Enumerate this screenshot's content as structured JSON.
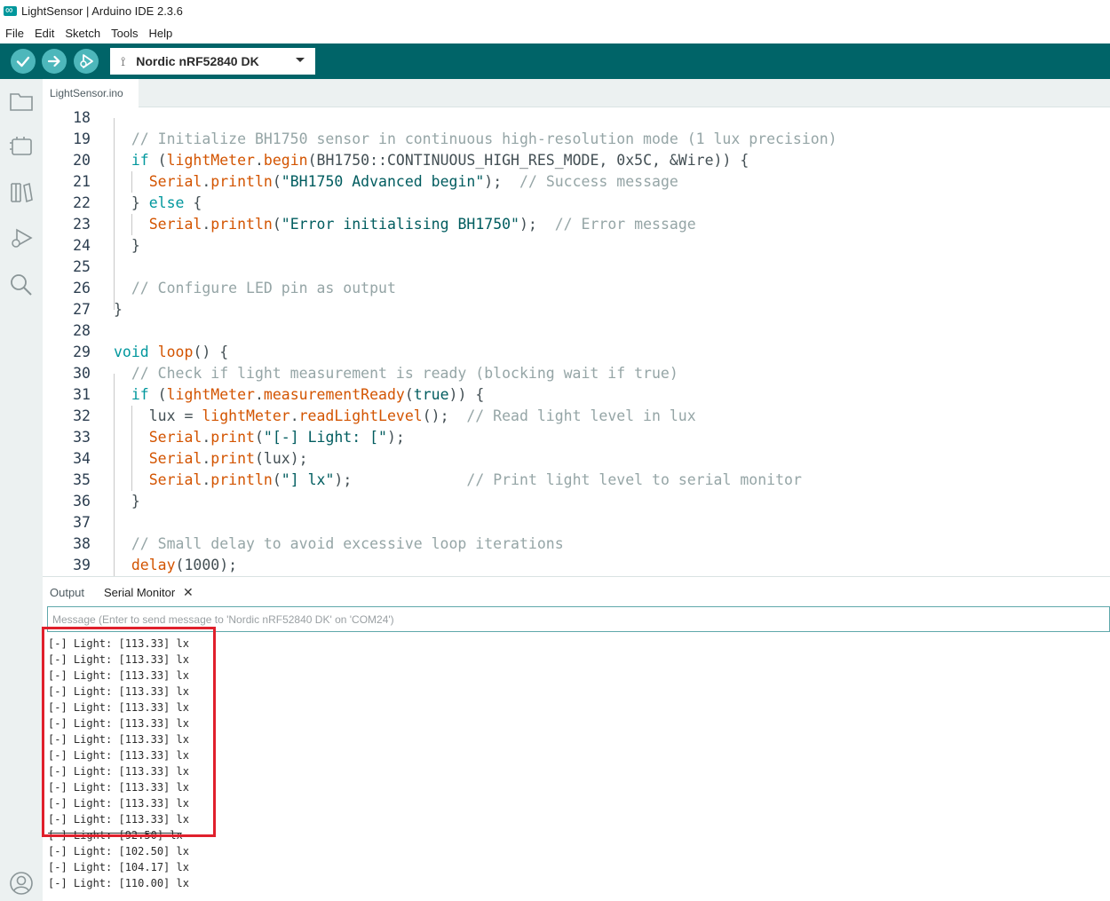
{
  "window": {
    "title": "LightSensor | Arduino IDE 2.3.6"
  },
  "menu": [
    "File",
    "Edit",
    "Sketch",
    "Tools",
    "Help"
  ],
  "toolbar": {
    "verify_icon": "check-icon",
    "upload_icon": "arrow-right-icon",
    "debug_icon": "debug-icon",
    "board": "Nordic nRF52840 DK",
    "colors": {
      "bar": "#006468",
      "button": "#4db7bb"
    }
  },
  "sidebar": {
    "icons": [
      "folder-icon",
      "board-manager-icon",
      "library-icon",
      "debug-icon",
      "search-icon",
      "account-icon"
    ]
  },
  "editor": {
    "tab": "LightSensor.ino",
    "lines": [
      {
        "num": "18",
        "segs": []
      },
      {
        "num": "19",
        "segs": [
          {
            "t": "  // Initialize BH1750 sensor in continuous high-resolution mode (1 lux precision)",
            "c": "cm"
          }
        ]
      },
      {
        "num": "20",
        "segs": [
          {
            "t": "  ",
            "c": "tx"
          },
          {
            "t": "if",
            "c": "kw"
          },
          {
            "t": " (",
            "c": "tx"
          },
          {
            "t": "lightMeter",
            "c": "fn"
          },
          {
            "t": ".",
            "c": "tx"
          },
          {
            "t": "begin",
            "c": "fn"
          },
          {
            "t": "(BH1750::CONTINUOUS_HIGH_RES_MODE, 0x5C, &Wire)) {",
            "c": "tx"
          }
        ]
      },
      {
        "num": "21",
        "segs": [
          {
            "t": "    ",
            "c": "tx"
          },
          {
            "t": "Serial",
            "c": "fn"
          },
          {
            "t": ".",
            "c": "tx"
          },
          {
            "t": "println",
            "c": "fn"
          },
          {
            "t": "(",
            "c": "tx"
          },
          {
            "t": "\"BH1750 Advanced begin\"",
            "c": "st"
          },
          {
            "t": ");  ",
            "c": "tx"
          },
          {
            "t": "// Success message",
            "c": "cm"
          }
        ]
      },
      {
        "num": "22",
        "segs": [
          {
            "t": "  } ",
            "c": "tx"
          },
          {
            "t": "else",
            "c": "kw"
          },
          {
            "t": " {",
            "c": "tx"
          }
        ]
      },
      {
        "num": "23",
        "segs": [
          {
            "t": "    ",
            "c": "tx"
          },
          {
            "t": "Serial",
            "c": "fn"
          },
          {
            "t": ".",
            "c": "tx"
          },
          {
            "t": "println",
            "c": "fn"
          },
          {
            "t": "(",
            "c": "tx"
          },
          {
            "t": "\"Error initialising BH1750\"",
            "c": "st"
          },
          {
            "t": ");  ",
            "c": "tx"
          },
          {
            "t": "// Error message",
            "c": "cm"
          }
        ]
      },
      {
        "num": "24",
        "segs": [
          {
            "t": "  }",
            "c": "tx"
          }
        ]
      },
      {
        "num": "25",
        "segs": []
      },
      {
        "num": "26",
        "segs": [
          {
            "t": "  // Configure LED pin as output",
            "c": "cm"
          }
        ]
      },
      {
        "num": "27",
        "segs": [
          {
            "t": "}",
            "c": "tx"
          }
        ]
      },
      {
        "num": "28",
        "segs": []
      },
      {
        "num": "29",
        "segs": [
          {
            "t": "void",
            "c": "kw"
          },
          {
            "t": " ",
            "c": "tx"
          },
          {
            "t": "loop",
            "c": "fn"
          },
          {
            "t": "() {",
            "c": "tx"
          }
        ]
      },
      {
        "num": "30",
        "segs": [
          {
            "t": "  // Check if light measurement is ready (blocking wait if true)",
            "c": "cm"
          }
        ]
      },
      {
        "num": "31",
        "segs": [
          {
            "t": "  ",
            "c": "tx"
          },
          {
            "t": "if",
            "c": "kw"
          },
          {
            "t": " (",
            "c": "tx"
          },
          {
            "t": "lightMeter",
            "c": "fn"
          },
          {
            "t": ".",
            "c": "tx"
          },
          {
            "t": "measurementReady",
            "c": "fn"
          },
          {
            "t": "(",
            "c": "tx"
          },
          {
            "t": "true",
            "c": "st"
          },
          {
            "t": ")) {",
            "c": "tx"
          }
        ]
      },
      {
        "num": "32",
        "segs": [
          {
            "t": "    lux = ",
            "c": "tx"
          },
          {
            "t": "lightMeter",
            "c": "fn"
          },
          {
            "t": ".",
            "c": "tx"
          },
          {
            "t": "readLightLevel",
            "c": "fn"
          },
          {
            "t": "();  ",
            "c": "tx"
          },
          {
            "t": "// Read light level in lux",
            "c": "cm"
          }
        ]
      },
      {
        "num": "33",
        "segs": [
          {
            "t": "    ",
            "c": "tx"
          },
          {
            "t": "Serial",
            "c": "fn"
          },
          {
            "t": ".",
            "c": "tx"
          },
          {
            "t": "print",
            "c": "fn"
          },
          {
            "t": "(",
            "c": "tx"
          },
          {
            "t": "\"[-] Light: [\"",
            "c": "st"
          },
          {
            "t": ");",
            "c": "tx"
          }
        ]
      },
      {
        "num": "34",
        "segs": [
          {
            "t": "    ",
            "c": "tx"
          },
          {
            "t": "Serial",
            "c": "fn"
          },
          {
            "t": ".",
            "c": "tx"
          },
          {
            "t": "print",
            "c": "fn"
          },
          {
            "t": "(lux);",
            "c": "tx"
          }
        ]
      },
      {
        "num": "35",
        "segs": [
          {
            "t": "    ",
            "c": "tx"
          },
          {
            "t": "Serial",
            "c": "fn"
          },
          {
            "t": ".",
            "c": "tx"
          },
          {
            "t": "println",
            "c": "fn"
          },
          {
            "t": "(",
            "c": "tx"
          },
          {
            "t": "\"] lx\"",
            "c": "st"
          },
          {
            "t": ");             ",
            "c": "tx"
          },
          {
            "t": "// Print light level to serial monitor",
            "c": "cm"
          }
        ]
      },
      {
        "num": "36",
        "segs": [
          {
            "t": "  }",
            "c": "tx"
          }
        ]
      },
      {
        "num": "37",
        "segs": []
      },
      {
        "num": "38",
        "segs": [
          {
            "t": "  // Small delay to avoid excessive loop iterations",
            "c": "cm"
          }
        ]
      },
      {
        "num": "39",
        "segs": [
          {
            "t": "  ",
            "c": "tx"
          },
          {
            "t": "delay",
            "c": "fn"
          },
          {
            "t": "(1000);",
            "c": "tx"
          }
        ]
      }
    ]
  },
  "panel": {
    "tabs": [
      "Output",
      "Serial Monitor"
    ],
    "close_icon": "close-icon",
    "input_placeholder": "Message (Enter to send message to 'Nordic nRF52840 DK' on 'COM24')",
    "monitor_lines": [
      "[-] Light: [113.33] lx",
      "[-] Light: [113.33] lx",
      "[-] Light: [113.33] lx",
      "[-] Light: [113.33] lx",
      "[-] Light: [113.33] lx",
      "[-] Light: [113.33] lx",
      "[-] Light: [113.33] lx",
      "[-] Light: [113.33] lx",
      "[-] Light: [113.33] lx",
      "[-] Light: [113.33] lx",
      "[-] Light: [113.33] lx",
      "[-] Light: [113.33] lx",
      "[-] Light: [92.50] lx",
      "[-] Light: [102.50] lx",
      "[-] Light: [104.17] lx",
      "[-] Light: [110.00] lx"
    ],
    "highlight_color": "#e0202c"
  }
}
